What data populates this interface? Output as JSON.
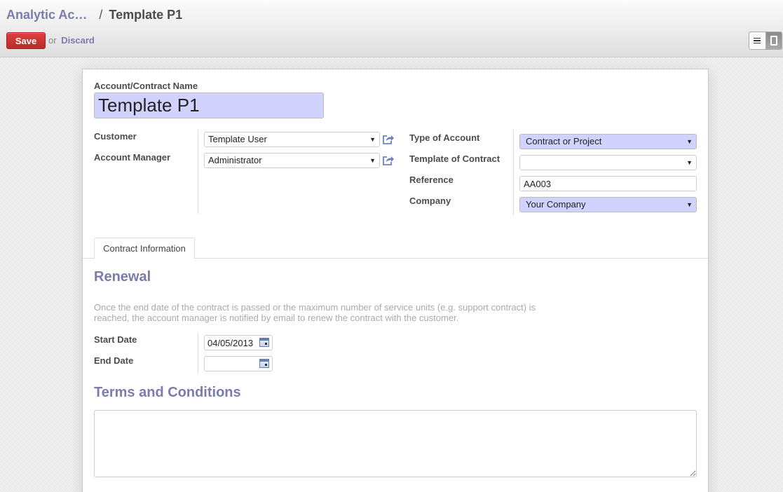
{
  "breadcrumb": {
    "parent": "Analytic Ac…",
    "separator": "/",
    "current": "Template P1"
  },
  "toolbar": {
    "save_label": "Save",
    "or_text": "or",
    "discard_label": "Discard"
  },
  "view_switcher": {
    "list_icon": "list-icon",
    "form_icon": "form-icon",
    "active": "form"
  },
  "form": {
    "name_label": "Account/Contract Name",
    "name_value": "Template P1",
    "customer": {
      "label": "Customer",
      "value": "Template User"
    },
    "account_manager": {
      "label": "Account Manager",
      "value": "Administrator"
    },
    "type_of_account": {
      "label": "Type of Account",
      "value": "Contract or Project"
    },
    "template_of_contract": {
      "label": "Template of Contract",
      "value": ""
    },
    "reference": {
      "label": "Reference",
      "value": "AA003"
    },
    "company": {
      "label": "Company",
      "value": "Your Company"
    }
  },
  "tabs": [
    {
      "label": "Contract Information",
      "active": true
    }
  ],
  "renewal": {
    "title": "Renewal",
    "help_line1": "Once the end date of the contract is passed or the maximum number of service units (e.g. support contract) is",
    "help_line2": "reached, the account manager is notified by email to renew the contract with the customer.",
    "start_date": {
      "label": "Start Date",
      "value": "04/05/2013"
    },
    "end_date": {
      "label": "End Date",
      "value": ""
    }
  },
  "terms": {
    "title": "Terms and Conditions",
    "value": ""
  },
  "colors": {
    "accent": "#7c7bad",
    "save_button": "#c93232",
    "required_field": "#d2d2ff"
  }
}
